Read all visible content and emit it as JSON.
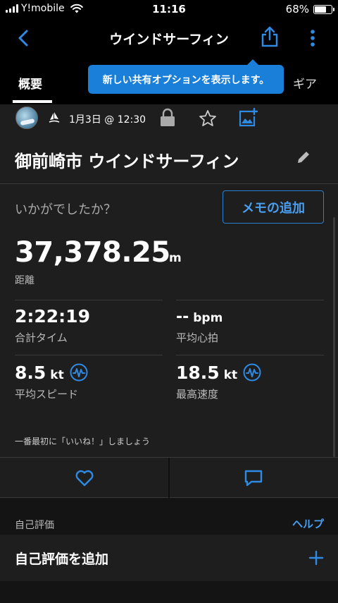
{
  "status_bar": {
    "carrier": "Y!mobile",
    "time": "11:16",
    "battery_percent": "68%",
    "battery_level": 0.68
  },
  "nav": {
    "title": "ウインドサーフィン"
  },
  "tabs": {
    "overview": "概要",
    "gear": "ギア"
  },
  "tooltip": {
    "text": "新しい共有オプションを表示します。"
  },
  "activity": {
    "date": "1月3日 @ 12:30",
    "title": "御前崎市 ウインドサーフィン",
    "feeling_prompt": "いかがでしたか？",
    "memo_button": "メモの追加",
    "distance": {
      "value": "37,378.25",
      "unit": "m",
      "label": "距離"
    },
    "stats": {
      "total_time": {
        "value": "2:22:19",
        "label": "合計タイム"
      },
      "avg_hr": {
        "value": "--",
        "unit": "bpm",
        "label": "平均心拍"
      },
      "avg_speed": {
        "value": "8.5",
        "unit": "kt",
        "label": "平均スピード"
      },
      "max_speed": {
        "value": "18.5",
        "unit": "kt",
        "label": "最高速度"
      }
    },
    "like_prompt": "一番最初に「いいね！」しましょう"
  },
  "self_eval": {
    "header": "自己評価",
    "help": "ヘルプ",
    "add_label": "自己評価を追加"
  },
  "colors": {
    "accent": "#1a7fd8",
    "link": "#4a9ef0",
    "background": "#000000",
    "panel": "#1e1e1e"
  }
}
